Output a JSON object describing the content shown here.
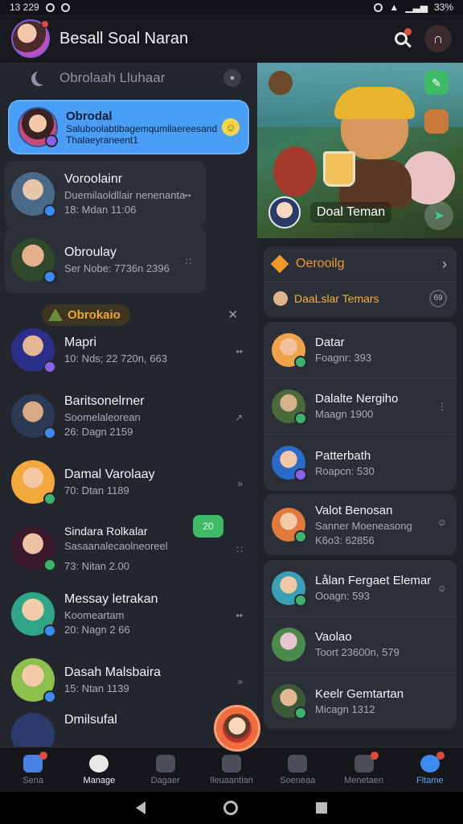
{
  "status": {
    "time": "13 229",
    "battery": "33%"
  },
  "header": {
    "title": "Besall Soal Naran"
  },
  "left": {
    "subheader": "Obrolaah Lluhaar",
    "active_chat": {
      "name": "Obrodal",
      "message": "Saluboolabtibagemqumilaereesand",
      "message2": "Thalaeyraneent1"
    },
    "chats": [
      {
        "name": "Voroolainr",
        "message": "Duemilaoldllair nenenanta",
        "time": "18: Mdan 11:06"
      },
      {
        "name": "Obroulay",
        "message": "",
        "time": "Ser Nobe: 7736n 2396"
      }
    ],
    "section_label": "Obrokaio",
    "chats2": [
      {
        "name": "Mapri",
        "message": "",
        "time": "10: Nds; 22 720n, 663"
      },
      {
        "name": "Baritsonelrner",
        "message": "Soomelaleorean",
        "time": "26: Dagn 2159"
      },
      {
        "name": "Damal Varolaay",
        "message": "",
        "time": "70: Dtan 1189"
      },
      {
        "name": "Sindara Rolkalar",
        "message": "Sasaanalecaolneoreel",
        "time": "73: Nitan 2.00",
        "badge": "20"
      },
      {
        "name": "Messay letrakan",
        "message": "Koomeartam",
        "time": "20: Nagn 2 66"
      },
      {
        "name": "Dasah Malsbaira",
        "message": "",
        "time": "15: Ntan 1139"
      },
      {
        "name": "Dmilsufal",
        "message": "",
        "time": ""
      }
    ]
  },
  "right": {
    "banner_label": "Doal Teman",
    "group_title": "Oerooilg",
    "group_sub": "DaaLslar Temars",
    "group_count": "69",
    "contacts1": [
      {
        "name": "Datar",
        "sub": "Foagnr: 393"
      },
      {
        "name": "Dalalte Nergiho",
        "sub": "Maagn 1900"
      },
      {
        "name": "Patterbath",
        "sub": "Roapcn: 530"
      }
    ],
    "contacts2": [
      {
        "name": "Valot Benosan",
        "sub": "Sanner Moeneasong",
        "sub2": "K6o3: 62856"
      }
    ],
    "contacts3": [
      {
        "name": "Lålan Fergaet Elemar",
        "sub": "Ooagn: 593"
      },
      {
        "name": "Vaolao",
        "sub": "Toort 23600n, 579"
      },
      {
        "name": "Keelr Gemtartan",
        "sub": "Micagn 1312"
      }
    ]
  },
  "nav": [
    {
      "label": "Sena"
    },
    {
      "label": "Manage"
    },
    {
      "label": "Dagaer"
    },
    {
      "label": "Ileuaantian"
    },
    {
      "label": "Soeneaa"
    },
    {
      "label": "Menetaen"
    },
    {
      "label": "Fltame"
    }
  ]
}
